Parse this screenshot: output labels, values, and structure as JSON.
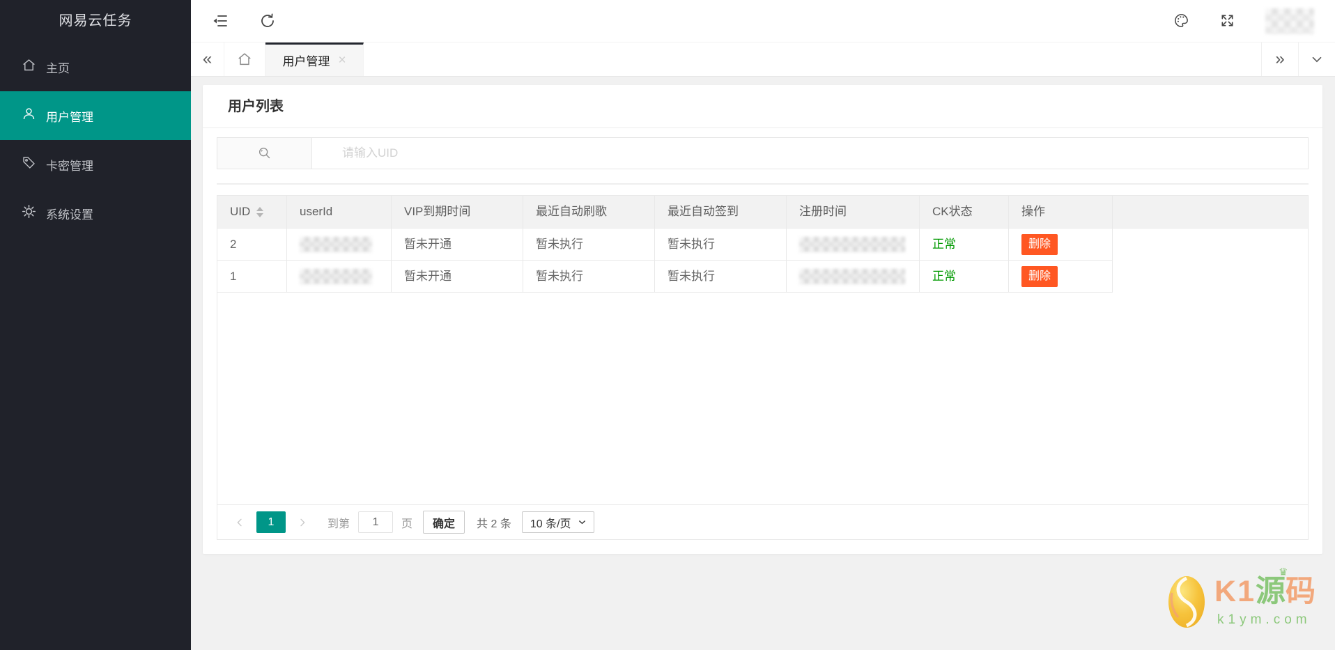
{
  "app": {
    "title": "网易云任务"
  },
  "sidebar": {
    "items": [
      {
        "label": "主页",
        "icon": "home-icon",
        "active": false
      },
      {
        "label": "用户管理",
        "icon": "user-icon",
        "active": true
      },
      {
        "label": "卡密管理",
        "icon": "tag-icon",
        "active": false
      },
      {
        "label": "系统设置",
        "icon": "gear-icon",
        "active": false
      }
    ]
  },
  "topbar": {
    "icons": [
      "collapse-menu-icon",
      "refresh-icon",
      "palette-icon",
      "fullscreen-icon"
    ],
    "user_redacted": true
  },
  "tabbar": {
    "left_arrow": "«",
    "active_tab": {
      "label": "用户管理",
      "close": "×"
    },
    "right_arrow": "»"
  },
  "page": {
    "card_title": "用户列表",
    "search": {
      "placeholder": "请输入UID",
      "value": ""
    },
    "table": {
      "columns": [
        "UID",
        "userId",
        "VIP到期时间",
        "最近自动刷歌",
        "最近自动签到",
        "注册时间",
        "CK状态",
        "操作"
      ],
      "sorted_column": "UID",
      "rows": [
        {
          "uid": "2",
          "user_id_redacted": true,
          "vip_expire": "暂未开通",
          "last_song": "暂未执行",
          "last_sign": "暂未执行",
          "register_time_redacted": true,
          "ck_status": "正常",
          "action": "删除"
        },
        {
          "uid": "1",
          "user_id_redacted": true,
          "vip_expire": "暂未开通",
          "last_song": "暂未执行",
          "last_sign": "暂未执行",
          "register_time_redacted": true,
          "ck_status": "正常",
          "action": "删除"
        }
      ]
    },
    "pagination": {
      "current_page": "1",
      "goto_label": "到第",
      "goto_value": "1",
      "goto_unit": "页",
      "confirm_label": "确定",
      "total_label": "共 2 条",
      "page_size": "10 条/页"
    }
  },
  "watermark": {
    "k1": "K1",
    "yuan": "源",
    "ma": "码",
    "domain": "k1ym.com"
  },
  "colors": {
    "sidebar_bg": "#20222a",
    "accent_teal": "#009688",
    "danger_orange": "#ff5722",
    "status_ok_green": "#009900",
    "tab_indicator": "#23262e"
  }
}
